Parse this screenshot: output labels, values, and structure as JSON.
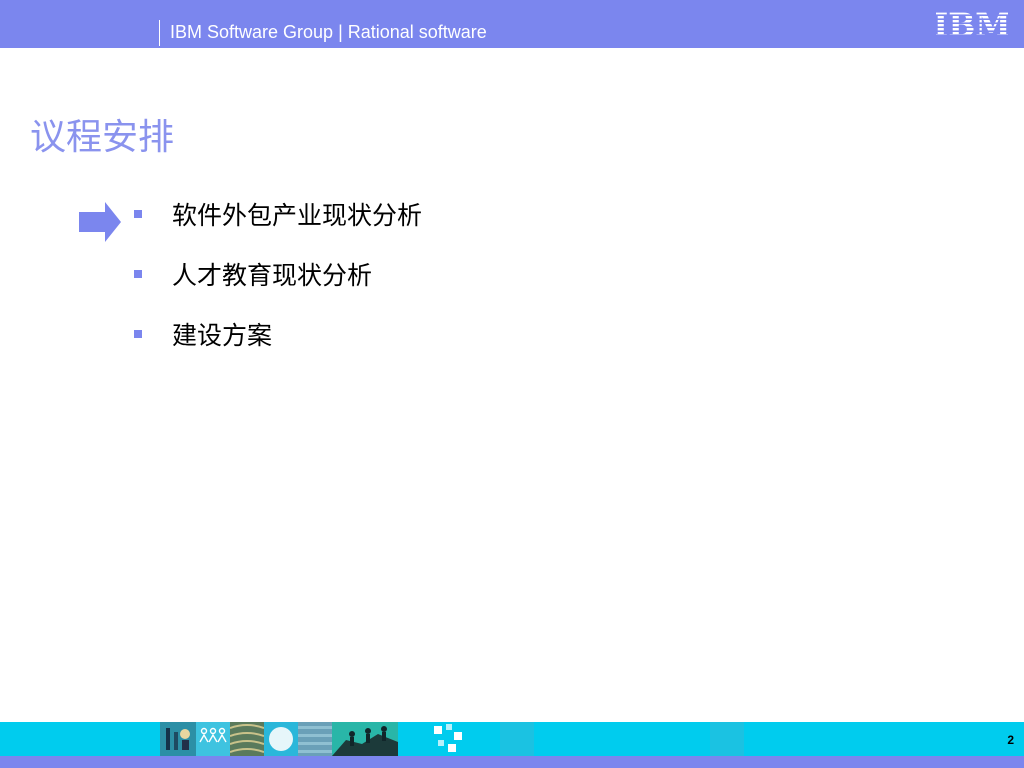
{
  "header": {
    "group_text": "IBM Software Group | Rational software",
    "logo_text": "IBM"
  },
  "slide": {
    "title": "议程安排",
    "items": [
      {
        "label": "软件外包产业现状分析",
        "current": true
      },
      {
        "label": "人才教育现状分析",
        "current": false
      },
      {
        "label": "建设方案",
        "current": false
      }
    ]
  },
  "footer": {
    "page_number": "2"
  },
  "colors": {
    "header_bg": "#7b86ee",
    "title": "#8a93ee",
    "accent_cyan": "#00ccee"
  }
}
